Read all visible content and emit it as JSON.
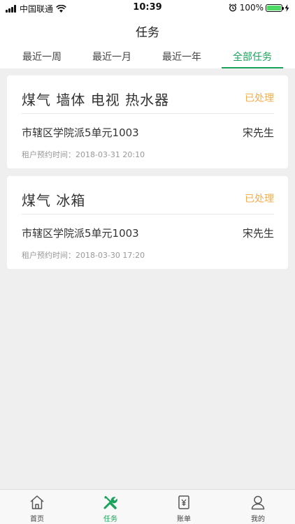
{
  "status_bar": {
    "carrier": "中国联通",
    "time": "10:39",
    "battery": "100%"
  },
  "header": {
    "title": "任务"
  },
  "tabs": [
    {
      "label": "最近一周",
      "active": false
    },
    {
      "label": "最近一月",
      "active": false
    },
    {
      "label": "最近一年",
      "active": false
    },
    {
      "label": "全部任务",
      "active": true
    }
  ],
  "tasks": [
    {
      "title": "煤气 墙体 电视 热水器",
      "status": "已处理",
      "address": "市辖区学院派5单元1003",
      "tenant": "宋先生",
      "time_label": "租户预约时间：",
      "time": "2018-03-31 20:10"
    },
    {
      "title": "煤气 冰箱",
      "status": "已处理",
      "address": "市辖区学院派5单元1003",
      "tenant": "宋先生",
      "time_label": "租户预约时间：",
      "time": "2018-03-30 17:20"
    }
  ],
  "tabbar": [
    {
      "label": "首页",
      "icon": "home-icon",
      "active": false
    },
    {
      "label": "任务",
      "icon": "tools-icon",
      "active": true
    },
    {
      "label": "账单",
      "icon": "bill-icon",
      "active": false
    },
    {
      "label": "我的",
      "icon": "user-icon",
      "active": false
    }
  ],
  "colors": {
    "accent": "#1aa35b",
    "status_done": "#f0ad4e",
    "background": "#efefef"
  }
}
